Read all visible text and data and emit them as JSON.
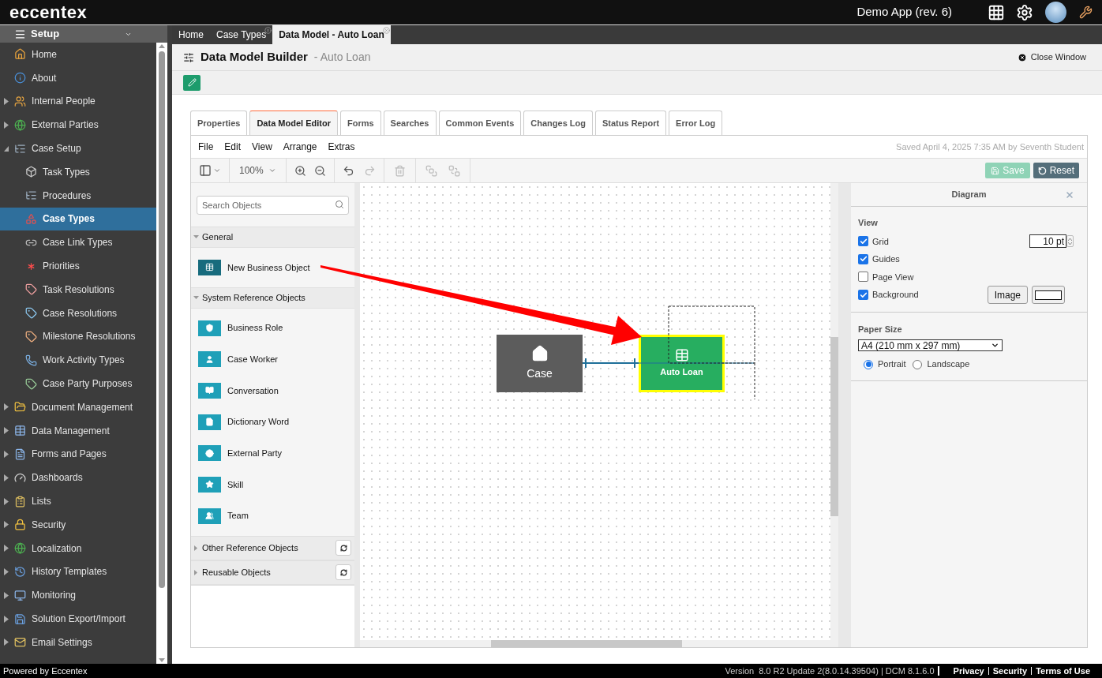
{
  "app": {
    "logo": "eccentex",
    "title": "Demo App (rev. 6)"
  },
  "sidebar": {
    "header": "Setup",
    "items": [
      {
        "label": "Home",
        "kind": "leaf",
        "selected": false
      },
      {
        "label": "About",
        "kind": "leaf",
        "selected": false
      },
      {
        "label": "Internal People",
        "kind": "group",
        "expanded": false,
        "selected": false
      },
      {
        "label": "External Parties",
        "kind": "group",
        "expanded": false,
        "selected": false
      },
      {
        "label": "Case Setup",
        "kind": "group",
        "expanded": true,
        "selected": false,
        "children": [
          {
            "label": "Task Types",
            "selected": false
          },
          {
            "label": "Procedures",
            "selected": false
          },
          {
            "label": "Case Types",
            "selected": true
          },
          {
            "label": "Case Link Types",
            "selected": false
          },
          {
            "label": "Priorities",
            "selected": false
          },
          {
            "label": "Task Resolutions",
            "selected": false
          },
          {
            "label": "Case Resolutions",
            "selected": false
          },
          {
            "label": "Milestone Resolutions",
            "selected": false
          },
          {
            "label": "Work Activity Types",
            "selected": false
          },
          {
            "label": "Case Party Purposes",
            "selected": false
          }
        ]
      },
      {
        "label": "Document Management",
        "kind": "group",
        "expanded": false,
        "selected": false
      },
      {
        "label": "Data Management",
        "kind": "group",
        "expanded": false,
        "selected": false
      },
      {
        "label": "Forms and Pages",
        "kind": "group",
        "expanded": false,
        "selected": false
      },
      {
        "label": "Dashboards",
        "kind": "group",
        "expanded": false,
        "selected": false
      },
      {
        "label": "Lists",
        "kind": "group",
        "expanded": false,
        "selected": false
      },
      {
        "label": "Security",
        "kind": "group",
        "expanded": false,
        "selected": false
      },
      {
        "label": "Localization",
        "kind": "group",
        "expanded": false,
        "selected": false
      },
      {
        "label": "History Templates",
        "kind": "group",
        "expanded": false,
        "selected": false
      },
      {
        "label": "Monitoring",
        "kind": "group",
        "expanded": false,
        "selected": false
      },
      {
        "label": "Solution Export/Import",
        "kind": "group",
        "expanded": false,
        "selected": false
      },
      {
        "label": "Email Settings",
        "kind": "group",
        "expanded": false,
        "selected": false
      }
    ]
  },
  "tabs": [
    {
      "label": "Home",
      "closable": false,
      "selected": false
    },
    {
      "label": "Case Types",
      "closable": true,
      "selected": false
    },
    {
      "label": "Data Model - Auto Loan",
      "closable": true,
      "selected": true
    }
  ],
  "page": {
    "title": "Data Model Builder",
    "subtitle": "- Auto Loan",
    "close": "Close Window"
  },
  "editor_tabs": [
    {
      "label": "Properties",
      "selected": false
    },
    {
      "label": "Data Model Editor",
      "selected": true
    },
    {
      "label": "Forms",
      "selected": false
    },
    {
      "label": "Searches",
      "selected": false
    },
    {
      "label": "Common Events",
      "selected": false
    },
    {
      "label": "Changes Log",
      "selected": false
    },
    {
      "label": "Status Report",
      "selected": false
    },
    {
      "label": "Error Log",
      "selected": false
    }
  ],
  "menu": [
    "File",
    "Edit",
    "View",
    "Arrange",
    "Extras"
  ],
  "saved": "Saved April 4, 2025 7:35 AM by Seventh Student",
  "toolbar": {
    "zoom": "100%",
    "save": {
      "label": "Save",
      "disabled": true
    },
    "reset": "Reset"
  },
  "palette": {
    "placeholder": "Search Objects",
    "sections": [
      {
        "title": "General",
        "expanded": true,
        "items": [
          {
            "label": "New Business Object",
            "color": "#176b7d"
          }
        ]
      },
      {
        "title": "System Reference Objects",
        "expanded": true,
        "items": [
          {
            "label": "Business Role",
            "color": "#1fa0b8"
          },
          {
            "label": "Case Worker",
            "color": "#1fa0b8"
          },
          {
            "label": "Conversation",
            "color": "#1fa0b8"
          },
          {
            "label": "Dictionary Word",
            "color": "#1fa0b8"
          },
          {
            "label": "External Party",
            "color": "#1fa0b8"
          },
          {
            "label": "Skill",
            "color": "#1fa0b8"
          },
          {
            "label": "Team",
            "color": "#1fa0b8"
          }
        ]
      },
      {
        "title": "Other Reference Objects",
        "expanded": false
      },
      {
        "title": "Reusable Objects",
        "expanded": false
      }
    ]
  },
  "diagram": {
    "nodes": [
      {
        "label": "Case",
        "color": "#5c5c5c",
        "selected": false
      },
      {
        "label": "Auto Loan",
        "color": "#27ae60",
        "selected": true
      }
    ]
  },
  "format_panel": {
    "title": "Diagram",
    "view_label": "View",
    "options": [
      {
        "label": "Grid",
        "checked": true
      },
      {
        "label": "Guides",
        "checked": true
      },
      {
        "label": "Page View",
        "checked": false
      },
      {
        "label": "Background",
        "checked": true
      }
    ],
    "grid_size": "10 pt",
    "image_button": "Image",
    "paper_label": "Paper Size",
    "paper_value": "A4 (210 mm x 297 mm)",
    "orientation": [
      {
        "label": "Portrait",
        "selected": true
      },
      {
        "label": "Landscape",
        "selected": false
      }
    ]
  },
  "footer": {
    "powered": "Powered by Eccentex",
    "version_label": "Version",
    "version": "8.0 R2 Update 2(8.0.14.39504) | DCM 8.1.6.0",
    "links": [
      "Privacy",
      "Security",
      "Terms of Use"
    ]
  }
}
